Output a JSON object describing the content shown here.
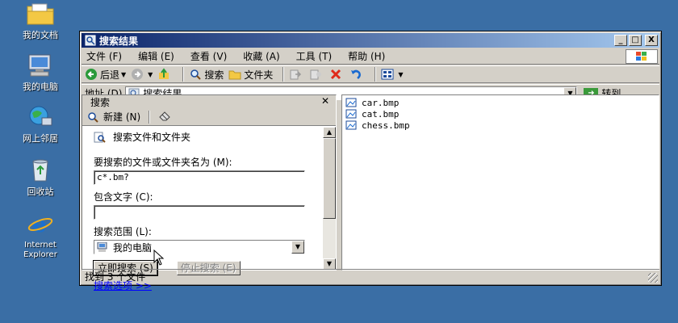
{
  "desktop": {
    "icons": [
      {
        "label": "我的文档"
      },
      {
        "label": "我的电脑"
      },
      {
        "label": "网上邻居"
      },
      {
        "label": "回收站"
      },
      {
        "label": "Internet Explorer"
      }
    ]
  },
  "window": {
    "title": "搜索结果",
    "controls": {
      "minimize": "_",
      "maximize": "□",
      "close": "X"
    }
  },
  "menubar": {
    "items": [
      {
        "label": "文件 (F)"
      },
      {
        "label": "编辑 (E)"
      },
      {
        "label": "查看 (V)"
      },
      {
        "label": "收藏 (A)"
      },
      {
        "label": "工具 (T)"
      },
      {
        "label": "帮助 (H)"
      }
    ]
  },
  "toolbar": {
    "back_label": "后退",
    "search_label": "搜索",
    "folders_label": "文件夹"
  },
  "addressbar": {
    "label": "地址 (D)",
    "value": "搜索结果",
    "go_label": "转到"
  },
  "search_pane": {
    "title": "搜索",
    "new_label": "新建 (N)",
    "heading": "搜索文件和文件夹",
    "name_label": "要搜索的文件或文件夹名为 (M):",
    "name_value": "c*.bm?",
    "text_label": "包含文字 (C):",
    "text_value": "",
    "scope_label": "搜索范围 (L):",
    "scope_value": "我的电脑",
    "search_now_label": "立即搜索 (S)",
    "stop_label": "停止搜索 (E)",
    "options_link": "搜索选项 >>"
  },
  "results": {
    "files": [
      {
        "name": "car.bmp"
      },
      {
        "name": "cat.bmp"
      },
      {
        "name": "chess.bmp"
      }
    ]
  },
  "statusbar": {
    "text": "找到 3 个文件"
  }
}
